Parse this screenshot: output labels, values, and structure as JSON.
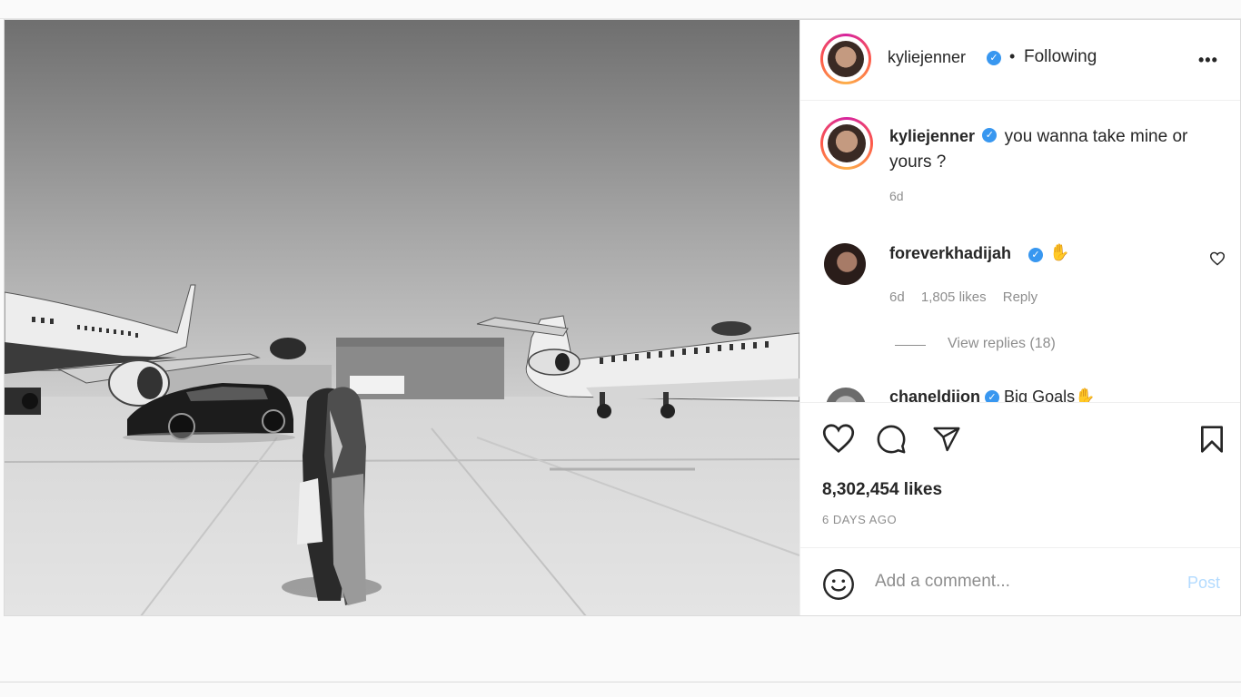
{
  "post": {
    "author": "kyliejenner",
    "follow_status": "Following",
    "separator": "•",
    "more_icon": "more-horizontal-icon",
    "caption": {
      "username": "kyliejenner",
      "text": "you wanna take mine or yours ?",
      "time": "6d"
    },
    "comments": [
      {
        "username": "foreverkhadijah",
        "emoji": "✋",
        "time": "6d",
        "likes": "1,805 likes",
        "reply_label": "Reply",
        "view_replies": "View replies (18)"
      },
      {
        "username": "chaneldjjon",
        "text": "Big Goals✋"
      }
    ],
    "likes_count": "8,302,454 likes",
    "posted_ago": "6 DAYS AGO",
    "add_comment_placeholder": "Add a comment...",
    "post_button": "Post"
  },
  "colors": {
    "verified": "#3897f0",
    "muted": "#8e8e8e",
    "post_disabled": "#b3dbff"
  }
}
